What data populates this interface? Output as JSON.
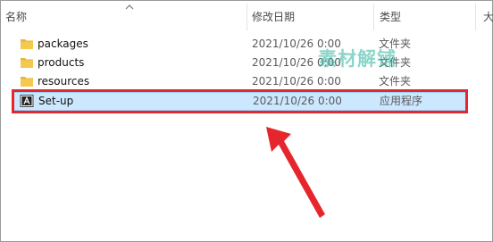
{
  "columns": {
    "name": "名称",
    "modified": "修改日期",
    "type": "类型",
    "size_partial": "大"
  },
  "files": [
    {
      "name": "packages",
      "date": "2021/10/26 0:00",
      "type": "文件夹",
      "icon": "folder-icon"
    },
    {
      "name": "products",
      "date": "2021/10/26 0:00",
      "type": "文件夹",
      "icon": "folder-icon"
    },
    {
      "name": "resources",
      "date": "2021/10/26 0:00",
      "type": "文件夹",
      "icon": "folder-icon"
    },
    {
      "name": "Set-up",
      "date": "2021/10/26 0:00",
      "type": "应用程序",
      "icon": "adobe-setup-icon",
      "selected": true
    }
  ],
  "watermark": "素材解铺",
  "colors": {
    "selection_fill": "#cce8ff",
    "highlight_border": "#e5272d",
    "folder": "#f0c14b",
    "watermark": "#2fb49f"
  }
}
